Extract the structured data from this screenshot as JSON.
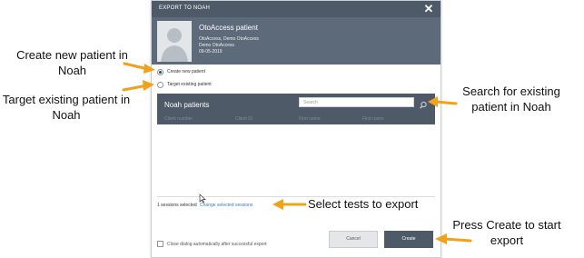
{
  "dialog": {
    "title": "EXPORT TO NOAH",
    "close_glyph": "✕",
    "patient": {
      "name": "OtoAccess patient",
      "line1": "OtoAccess, Demo OtoAccess",
      "line2": "Demo OtoAccess",
      "line3": "09-05-2019"
    },
    "options": {
      "create_new": "Create new patient",
      "target_existing": "Target existing patient",
      "selected": "create_new"
    },
    "noah_panel": {
      "title": "Noah patients",
      "search_placeholder": "Search",
      "columns": [
        "Client number",
        "Client ID",
        "First name",
        "First name"
      ]
    },
    "sessions": {
      "count_text": "1 sessions selected",
      "link_text": "Change selected sessions"
    },
    "close_after_export_label": "Close dialog automatically after successful export",
    "buttons": {
      "cancel": "Cancel",
      "create": "Create"
    }
  },
  "annotations": {
    "create_new": "Create new patient in Noah",
    "target_existing": "Target existing patient in Noah",
    "search": "Search for existing patient in Noah",
    "select_tests": "Select tests to export",
    "press_create": "Press Create to start export"
  },
  "colors": {
    "header_dark": "#4e5a68",
    "patient_band": "#5d6a79",
    "arrow": "#f0a21b",
    "link": "#3a7bbf"
  }
}
